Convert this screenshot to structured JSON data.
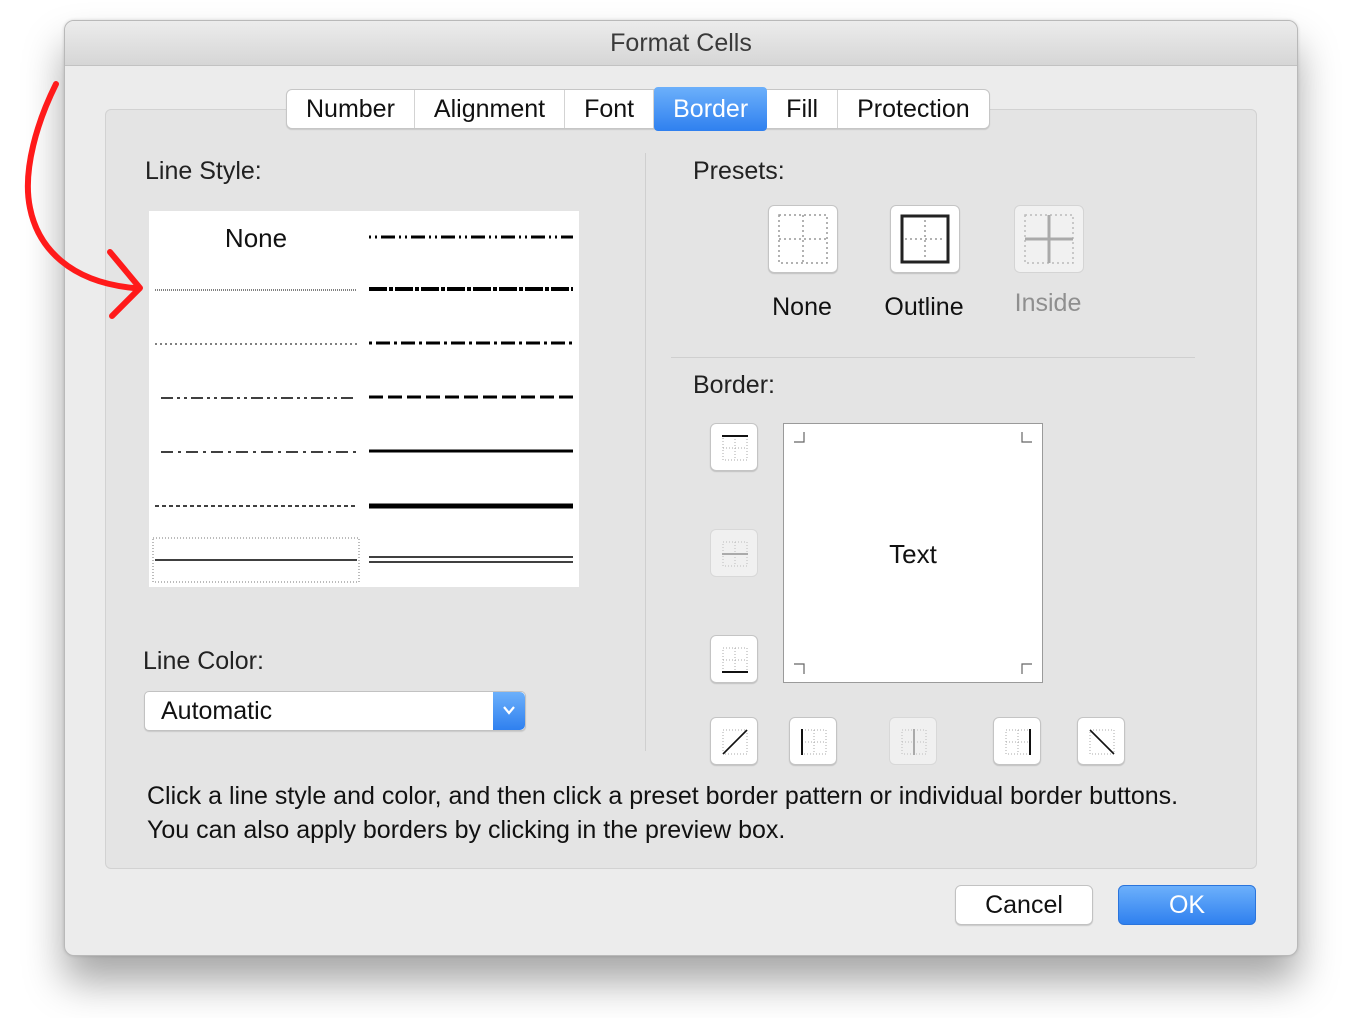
{
  "window": {
    "title": "Format Cells"
  },
  "tabs": [
    {
      "label": "Number"
    },
    {
      "label": "Alignment"
    },
    {
      "label": "Font"
    },
    {
      "label": "Border",
      "active": true
    },
    {
      "label": "Fill"
    },
    {
      "label": "Protection"
    }
  ],
  "line_style": {
    "label": "Line Style:",
    "none_label": "None",
    "selected": "thin-solid"
  },
  "line_color": {
    "label": "Line Color:",
    "value": "Automatic"
  },
  "presets": {
    "label": "Presets:",
    "items": [
      {
        "label": "None",
        "enabled": true
      },
      {
        "label": "Outline",
        "enabled": true
      },
      {
        "label": "Inside",
        "enabled": false
      }
    ]
  },
  "border": {
    "label": "Border:",
    "preview_text": "Text"
  },
  "help_text": "Click a line style and color, and then click a preset border pattern or individual border buttons. You can also apply borders by clicking in the preview box.",
  "buttons": {
    "cancel": "Cancel",
    "ok": "OK"
  },
  "colors": {
    "accent": "#2f80ef",
    "annotation": "#ff1a1a"
  }
}
